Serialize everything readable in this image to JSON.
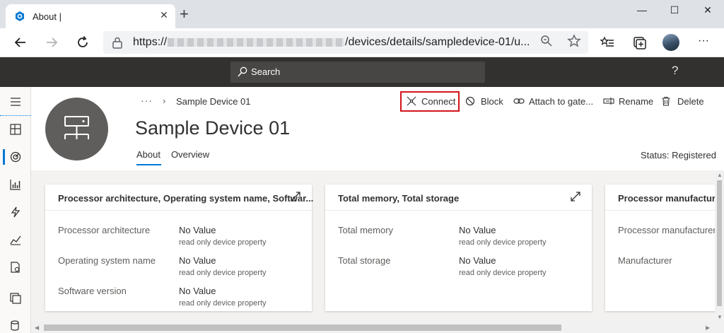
{
  "browser": {
    "tab_title": "About |",
    "tab_close": "✕",
    "new_tab": "+",
    "window_minimize": "—",
    "window_maximize": "☐",
    "window_close": "✕",
    "url_prefix": "https://",
    "url_suffix": "/devices/details/sampledevice-01/u...",
    "more_menu": "···"
  },
  "appbar": {
    "search_label": "Search",
    "help_label": "?"
  },
  "breadcrumb": {
    "overflow": "···",
    "separator": "›",
    "current": "Sample Device 01"
  },
  "commands": [
    {
      "label": "Connect",
      "icon": "connect-icon"
    },
    {
      "label": "Block",
      "icon": "block-icon"
    },
    {
      "label": "Attach to gate...",
      "icon": "attach-icon"
    },
    {
      "label": "Rename",
      "icon": "rename-icon"
    },
    {
      "label": "Delete",
      "icon": "delete-icon"
    }
  ],
  "device": {
    "title": "Sample Device 01",
    "status": "Status: Registered",
    "tabs": [
      {
        "label": "About",
        "selected": true
      },
      {
        "label": "Overview",
        "selected": false
      }
    ]
  },
  "cards": [
    {
      "title": "Processor architecture, Operating system name, Softwar...",
      "rows": [
        {
          "label": "Processor architecture",
          "value": "No Value",
          "sub": "read only device property"
        },
        {
          "label": "Operating system name",
          "value": "No Value",
          "sub": "read only device property"
        },
        {
          "label": "Software version",
          "value": "No Value",
          "sub": "read only device property"
        }
      ]
    },
    {
      "title": "Total memory, Total storage",
      "rows": [
        {
          "label": "Total memory",
          "value": "No Value",
          "sub": "read only device property"
        },
        {
          "label": "Total storage",
          "value": "No Value",
          "sub": "read only device property"
        }
      ]
    },
    {
      "title": "Processor manufacturer",
      "rows": [
        {
          "label": "Processor manufacturer"
        },
        {
          "label": "Manufacturer"
        }
      ]
    }
  ],
  "colors": {
    "accent": "#0078d4",
    "appbar_bg": "#323130",
    "highlight_box": "#d1141b",
    "content_bg": "#f3f2f1"
  }
}
